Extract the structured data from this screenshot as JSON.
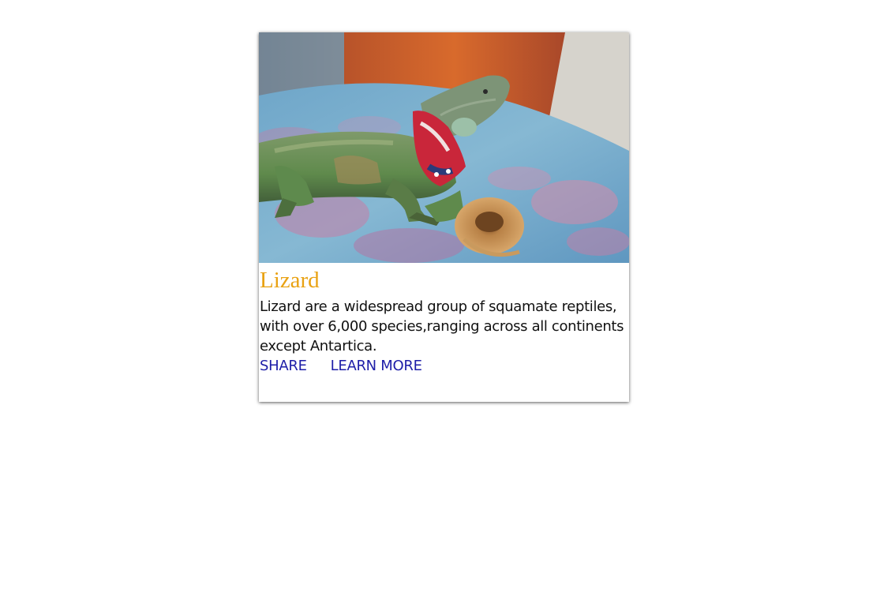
{
  "card": {
    "image_alt": "Iguana on a blue cloth with a red bandana and a woven basket",
    "title": "Lizard",
    "description": "Lizard are a widespread group of squamate reptiles, with over 6,000 species,ranging across all continents except Antartica.",
    "actions": {
      "share_label": "SHARE",
      "learn_more_label": "LEARN MORE"
    }
  },
  "colors": {
    "title": "#e9a213",
    "action_link": "#1e1ea8",
    "body_text": "#111111"
  }
}
